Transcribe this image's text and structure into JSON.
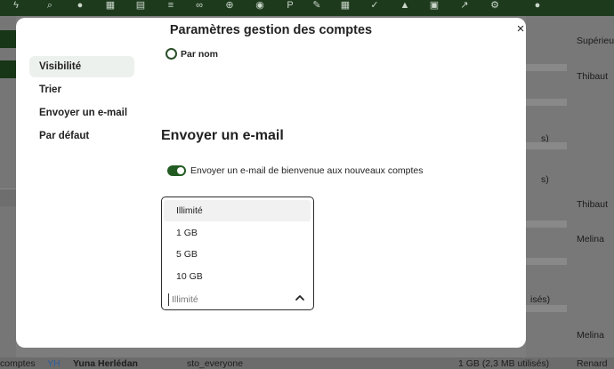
{
  "topbar": {
    "icons": [
      "bolt-icon",
      "search-icon",
      "user-icon",
      "calendar-icon",
      "grid-icon",
      "text-icon",
      "link-icon",
      "globe-icon",
      "people-icon",
      "parking-icon",
      "pen-icon",
      "table-icon",
      "check-icon",
      "graduation-icon",
      "bus-icon",
      "chart-icon",
      "settings-icon",
      "user-icon"
    ]
  },
  "background": {
    "column_header": "Supérieur",
    "right_values": [
      "Thibaut",
      "Thibaut",
      "Melina",
      "Melina"
    ],
    "right_partials": [
      "s)",
      "s)",
      "isés)"
    ],
    "bottom_row": {
      "left": "comptes",
      "avatar_initials": "YH",
      "name": "Yuna Herlédan",
      "group": "sto_everyone",
      "quota": "1 GB (2,3 MB utilisés)",
      "manager": "Renard"
    }
  },
  "modal": {
    "title": "Paramètres gestion des comptes",
    "close_label": "×",
    "nav": [
      {
        "label": "Visibilité",
        "active": true
      },
      {
        "label": "Trier",
        "active": false
      },
      {
        "label": "Envoyer un e-mail",
        "active": false
      },
      {
        "label": "Par défaut",
        "active": false
      }
    ],
    "radio_label": "Par nom",
    "section_title": "Envoyer un e-mail",
    "toggle_label": "Envoyer un e-mail de bienvenue aux nouveaux comptes",
    "toggle_on": true,
    "quota_select": {
      "options": [
        "Illimité",
        "1 GB",
        "5 GB",
        "10 GB"
      ],
      "highlighted": "Illimité",
      "placeholder": "Illimité"
    }
  },
  "colors": {
    "brand_dark_green": "#1d3a1d",
    "toggle_green": "#235c23",
    "nav_active_bg": "#edf1ed"
  }
}
